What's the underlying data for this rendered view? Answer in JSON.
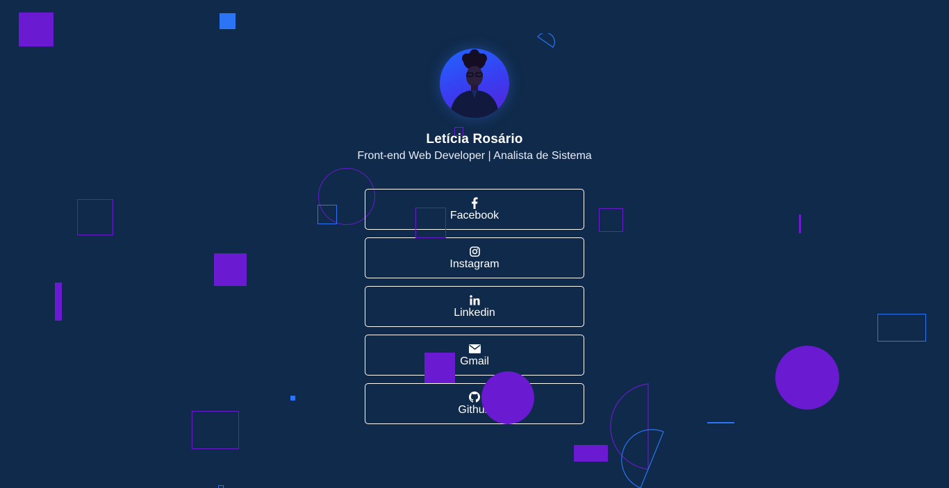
{
  "profile": {
    "name": "Letícia Rosário",
    "role": "Front-end Web Developer | Analista de Sistema",
    "avatar_icon": "profile-photo"
  },
  "links": [
    {
      "label": "Facebook",
      "icon": "facebook-icon"
    },
    {
      "label": "Instagram",
      "icon": "instagram-icon"
    },
    {
      "label": "Linkedin",
      "icon": "linkedin-icon"
    },
    {
      "label": "Gmail",
      "icon": "mail-icon"
    },
    {
      "label": "Github",
      "icon": "github-icon"
    }
  ],
  "colors": {
    "background": "#0f2a4a",
    "accent_purple": "#6a1ad1",
    "accent_blue": "#2a74f5",
    "button_border": "#ffffff",
    "text": "#ffffff"
  }
}
